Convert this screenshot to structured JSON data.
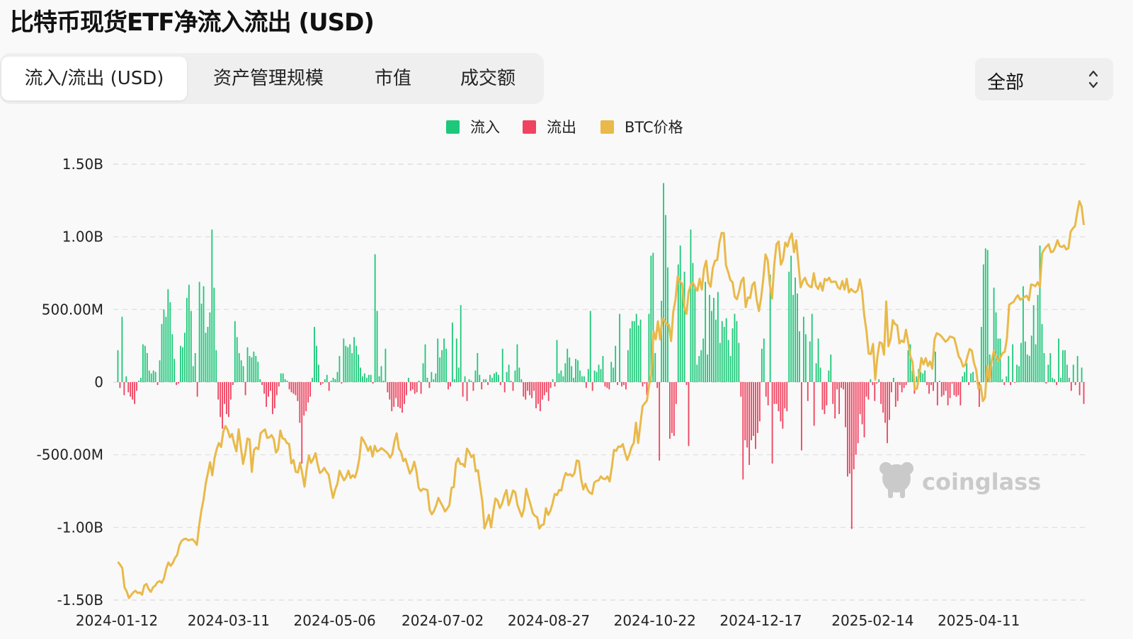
{
  "title": "比特币现货ETF净流入流出 (USD)",
  "tabs": [
    {
      "label": "流入/流出 (USD)",
      "active": true
    },
    {
      "label": "资产管理规模",
      "active": false
    },
    {
      "label": "市值",
      "active": false
    },
    {
      "label": "成交额",
      "active": false
    }
  ],
  "range_select": {
    "value": "全部",
    "icon": "updown-chevron-icon"
  },
  "watermark": "coinglass",
  "colors": {
    "inflow": "#1ec87a",
    "outflow": "#f0435f",
    "price": "#e9b949",
    "grid": "#dcdcdc"
  },
  "chart_data": {
    "type": "bar",
    "title": "",
    "legend": [
      {
        "name": "流入",
        "color": "#1ec87a"
      },
      {
        "name": "流出",
        "color": "#f0435f"
      },
      {
        "name": "BTC价格",
        "color": "#e9b949"
      }
    ],
    "legend_position": "top-center",
    "y_ticks": [
      "1.50B",
      "1.00B",
      "500.00M",
      "0",
      "-500.00M",
      "-1.00B",
      "-1.50B"
    ],
    "x_ticks": [
      "2024-01-12",
      "2024-03-11",
      "2024-05-06",
      "2024-07-02",
      "2024-08-27",
      "2024-10-22",
      "2024-12-17",
      "2025-02-14",
      "2025-04-11"
    ],
    "ylim": [
      -1500000000,
      1500000000
    ],
    "grid": true,
    "start_date": "2024-01-12",
    "values_millions": [
      220,
      -40,
      450,
      -90,
      40,
      -70,
      -100,
      -120,
      -150,
      -60,
      10,
      30,
      260,
      250,
      200,
      80,
      60,
      80,
      70,
      -20,
      150,
      400,
      500,
      450,
      640,
      550,
      330,
      160,
      -20,
      -10,
      250,
      240,
      340,
      580,
      670,
      490,
      110,
      200,
      -100,
      690,
      540,
      660,
      340,
      380,
      480,
      1050,
      650,
      220,
      -120,
      -240,
      -320,
      -150,
      -220,
      -240,
      -120,
      -20,
      420,
      310,
      200,
      150,
      110,
      -90,
      240,
      180,
      170,
      210,
      180,
      140,
      20,
      -20,
      -80,
      -170,
      -100,
      -60,
      -220,
      -180,
      -90,
      -30,
      60,
      60,
      20,
      10,
      -50,
      -70,
      -80,
      -90,
      -130,
      -280,
      -560,
      -230,
      -200,
      -140,
      -100,
      30,
      380,
      250,
      120,
      -20,
      -10,
      20,
      50,
      -60,
      10,
      30,
      20,
      70,
      180,
      -10,
      300,
      250,
      240,
      260,
      200,
      310,
      250,
      190,
      100,
      40,
      60,
      30,
      50,
      50,
      -10,
      880,
      490,
      40,
      110,
      10,
      230,
      -70,
      -120,
      -200,
      -170,
      -110,
      -170,
      -180,
      -210,
      -150,
      -90,
      30,
      -60,
      -50,
      -80,
      -70,
      10,
      -80,
      130,
      260,
      30,
      -40,
      70,
      20,
      60,
      300,
      170,
      220,
      300,
      230,
      -50,
      -30,
      410,
      20,
      300,
      100,
      530,
      -100,
      40,
      -130,
      20,
      10,
      -60,
      80,
      200,
      50,
      -50,
      20,
      20,
      -20,
      50,
      30,
      60,
      70,
      50,
      -20,
      230,
      -70,
      70,
      120,
      10,
      -60,
      80,
      260,
      100,
      20,
      -100,
      -120,
      -60,
      -90,
      -110,
      -60,
      -180,
      -150,
      -200,
      -120,
      -90,
      -70,
      -130,
      -40,
      20,
      -30,
      290,
      60,
      80,
      40,
      130,
      230,
      170,
      110,
      30,
      160,
      150,
      80,
      40,
      40,
      -40,
      90,
      490,
      -60,
      80,
      70,
      120,
      90,
      180,
      -30,
      -40,
      -50,
      140,
      100,
      250,
      -20,
      470,
      -30,
      -20,
      -50,
      220,
      370,
      420,
      420,
      470,
      390,
      430,
      -30,
      -10,
      -90,
      470,
      870,
      890,
      200,
      -40,
      -540,
      560,
      1370,
      1150,
      790,
      -390,
      -350,
      -370,
      -150,
      810,
      940,
      670,
      760,
      -20,
      -440,
      1050,
      820,
      660,
      120,
      180,
      220,
      300,
      690,
      190,
      600,
      490,
      580,
      430,
      620,
      270,
      420,
      380,
      440,
      290,
      180,
      370,
      470,
      420,
      270,
      -100,
      -670,
      -400,
      -450,
      -570,
      -400,
      -370,
      -460,
      -350,
      -270,
      230,
      300,
      -100,
      -160,
      740,
      -560,
      -150,
      -150,
      -200,
      -270,
      -320,
      -180,
      -200,
      760,
      870,
      600,
      720,
      610,
      350,
      -470,
      450,
      330,
      -130,
      280,
      470,
      -300,
      130,
      300,
      100,
      -190,
      -220,
      -160,
      80,
      190,
      -150,
      -250,
      -50,
      -220,
      -40,
      -50,
      -310,
      -650,
      -630,
      -1010,
      -600,
      -500,
      -420,
      -220,
      -290,
      -380,
      -100,
      -120,
      20,
      -20,
      -130,
      -10,
      20,
      -150,
      -210,
      -280,
      -420,
      -260,
      -70,
      30,
      -170,
      -130,
      -20,
      -70,
      -40,
      -20,
      220,
      260,
      80,
      -80,
      40,
      90,
      70,
      60,
      80,
      -20,
      -80,
      -20,
      -60,
      210,
      -160,
      10,
      -100,
      -90,
      -60,
      -160,
      -110,
      -10,
      -90,
      -100,
      -90,
      -160,
      40,
      70,
      130,
      -20,
      60,
      70,
      10,
      -10,
      -170,
      380,
      810,
      920,
      910,
      190,
      110,
      650,
      480,
      300,
      300,
      20,
      -20,
      40,
      180,
      -20,
      260,
      -5,
      120,
      110,
      270,
      660,
      280,
      190,
      180,
      320,
      530,
      260,
      600,
      940,
      400,
      200,
      -10,
      120,
      200,
      30,
      20,
      -20,
      300,
      30,
      220,
      220,
      120,
      30,
      -60,
      120,
      -20,
      180,
      -90,
      100,
      -150
    ],
    "price_usd": [
      48000,
      47500,
      46900,
      43500,
      42800,
      41600,
      42100,
      42600,
      42900,
      42500,
      42600,
      42200,
      43800,
      44100,
      43200,
      42700,
      43500,
      43800,
      44400,
      44600,
      44300,
      45100,
      46800,
      47900,
      47300,
      47800,
      48700,
      49200,
      50900,
      51700,
      52000,
      52100,
      51800,
      51900,
      52000,
      51600,
      51000,
      54400,
      57000,
      59000,
      61800,
      63700,
      65600,
      63300,
      66300,
      67900,
      69000,
      68300,
      71000,
      72000,
      71300,
      70000,
      70600,
      68800,
      67500,
      71400,
      68300,
      65300,
      67200,
      69800,
      69600,
      63900,
      67800,
      68200,
      67900,
      70700,
      71100,
      71400,
      69900,
      70000,
      70400,
      69700,
      67300,
      67900,
      71200,
      69800,
      69700,
      69000,
      68800,
      65400,
      66000,
      63900,
      63800,
      65500,
      63600,
      61300,
      64400,
      66800,
      65500,
      66200,
      67200,
      65200,
      63700,
      64000,
      64600,
      63900,
      63400,
      61200,
      59300,
      60800,
      61800,
      64100,
      63200,
      62400,
      63000,
      64100,
      62800,
      63300,
      62900,
      64200,
      66300,
      70000,
      69400,
      68600,
      67600,
      68400,
      66600,
      68500,
      67500,
      67700,
      68100,
      67800,
      67500,
      67100,
      66400,
      67100,
      69300,
      70700,
      68000,
      67400,
      65800,
      66200,
      64900,
      63600,
      64300,
      65700,
      64000,
      61100,
      60500,
      60900,
      60800,
      60700,
      57200,
      56400,
      57000,
      58000,
      59300,
      58500,
      57800,
      56900,
      57400,
      58000,
      61100,
      61200,
      65400,
      66300,
      65300,
      65300,
      64800,
      68000,
      67400,
      66500,
      66900,
      64000,
      64200,
      61400,
      58700,
      53900,
      55000,
      56300,
      54100,
      56900,
      59200,
      58800,
      57500,
      58300,
      59700,
      60700,
      58000,
      59200,
      60600,
      60300,
      58100,
      57000,
      56000,
      57400,
      60900,
      59400,
      58100,
      56600,
      56100,
      55900,
      53900,
      54500,
      54600,
      57500,
      56300,
      57000,
      58300,
      60000,
      59800,
      60700,
      60600,
      62500,
      63700,
      63300,
      63500,
      63100,
      63700,
      65900,
      65800,
      62700,
      60800,
      61800,
      60700,
      60200,
      60000,
      62000,
      62300,
      62400,
      63100,
      62700,
      62600,
      63100,
      62200,
      64700,
      67800,
      67600,
      68400,
      68300,
      68800,
      67300,
      66000,
      67000,
      68300,
      69000,
      72600,
      69000,
      72300,
      75500,
      76000,
      76500,
      79300,
      81000,
      88700,
      87300,
      90500,
      87300,
      91100,
      90600,
      90000,
      89900,
      87000,
      92200,
      94300,
      98400,
      97500,
      97200,
      93000,
      91800,
      95700,
      97000,
      97300,
      96500,
      95900,
      98000,
      96100,
      99800,
      101200,
      97400,
      96600,
      99900,
      101200,
      101300,
      104400,
      106100,
      106100,
      100400,
      99200,
      97800,
      97400,
      94800,
      94400,
      95800,
      97600,
      98200,
      93000,
      94700,
      94600,
      96900,
      97400,
      94300,
      92300,
      94600,
      98000,
      102300,
      101300,
      96900,
      94500,
      100500,
      104100,
      104600,
      100500,
      101400,
      104400,
      103700,
      105100,
      106000,
      102700,
      104800,
      100700,
      96500,
      97600,
      98200,
      97100,
      96700,
      96500,
      99000,
      96800,
      96200,
      97300,
      95900,
      98000,
      97700,
      98200,
      97400,
      97500,
      97500,
      96500,
      96200,
      97600,
      96100,
      98000,
      95600,
      96200,
      95800,
      95600,
      96000,
      97900,
      95800,
      91500,
      88800,
      84800,
      84700,
      86500,
      80200,
      84300,
      86800,
      86600,
      84600,
      94000,
      86100,
      87400,
      90700,
      90000,
      89800,
      86600,
      87100,
      86800,
      89000,
      86800,
      84300,
      83300,
      78500,
      78600,
      81000,
      84000,
      82900,
      84000,
      82600,
      83400,
      82100,
      87300,
      88400,
      88200,
      87900,
      87400,
      86900,
      87200,
      87800,
      87700,
      87500,
      86000,
      84300,
      83700,
      82500,
      82800,
      84300,
      85600,
      85300,
      83100,
      81900,
      78600,
      79200,
      76400,
      77000,
      82600,
      80000,
      83400,
      85200,
      84300,
      83600,
      84100,
      84900,
      85100,
      87500,
      93400,
      93700,
      93900,
      94600,
      95100,
      94300,
      94500,
      94800,
      95000,
      94200,
      97000,
      96900,
      96700,
      97400,
      96600,
      102500,
      103200,
      103700,
      104100,
      102700,
      102800,
      103600,
      104800,
      103800,
      103600,
      103900,
      103200,
      103400,
      106300,
      106900,
      107300,
      109700,
      111700,
      110800,
      107500
    ]
  }
}
